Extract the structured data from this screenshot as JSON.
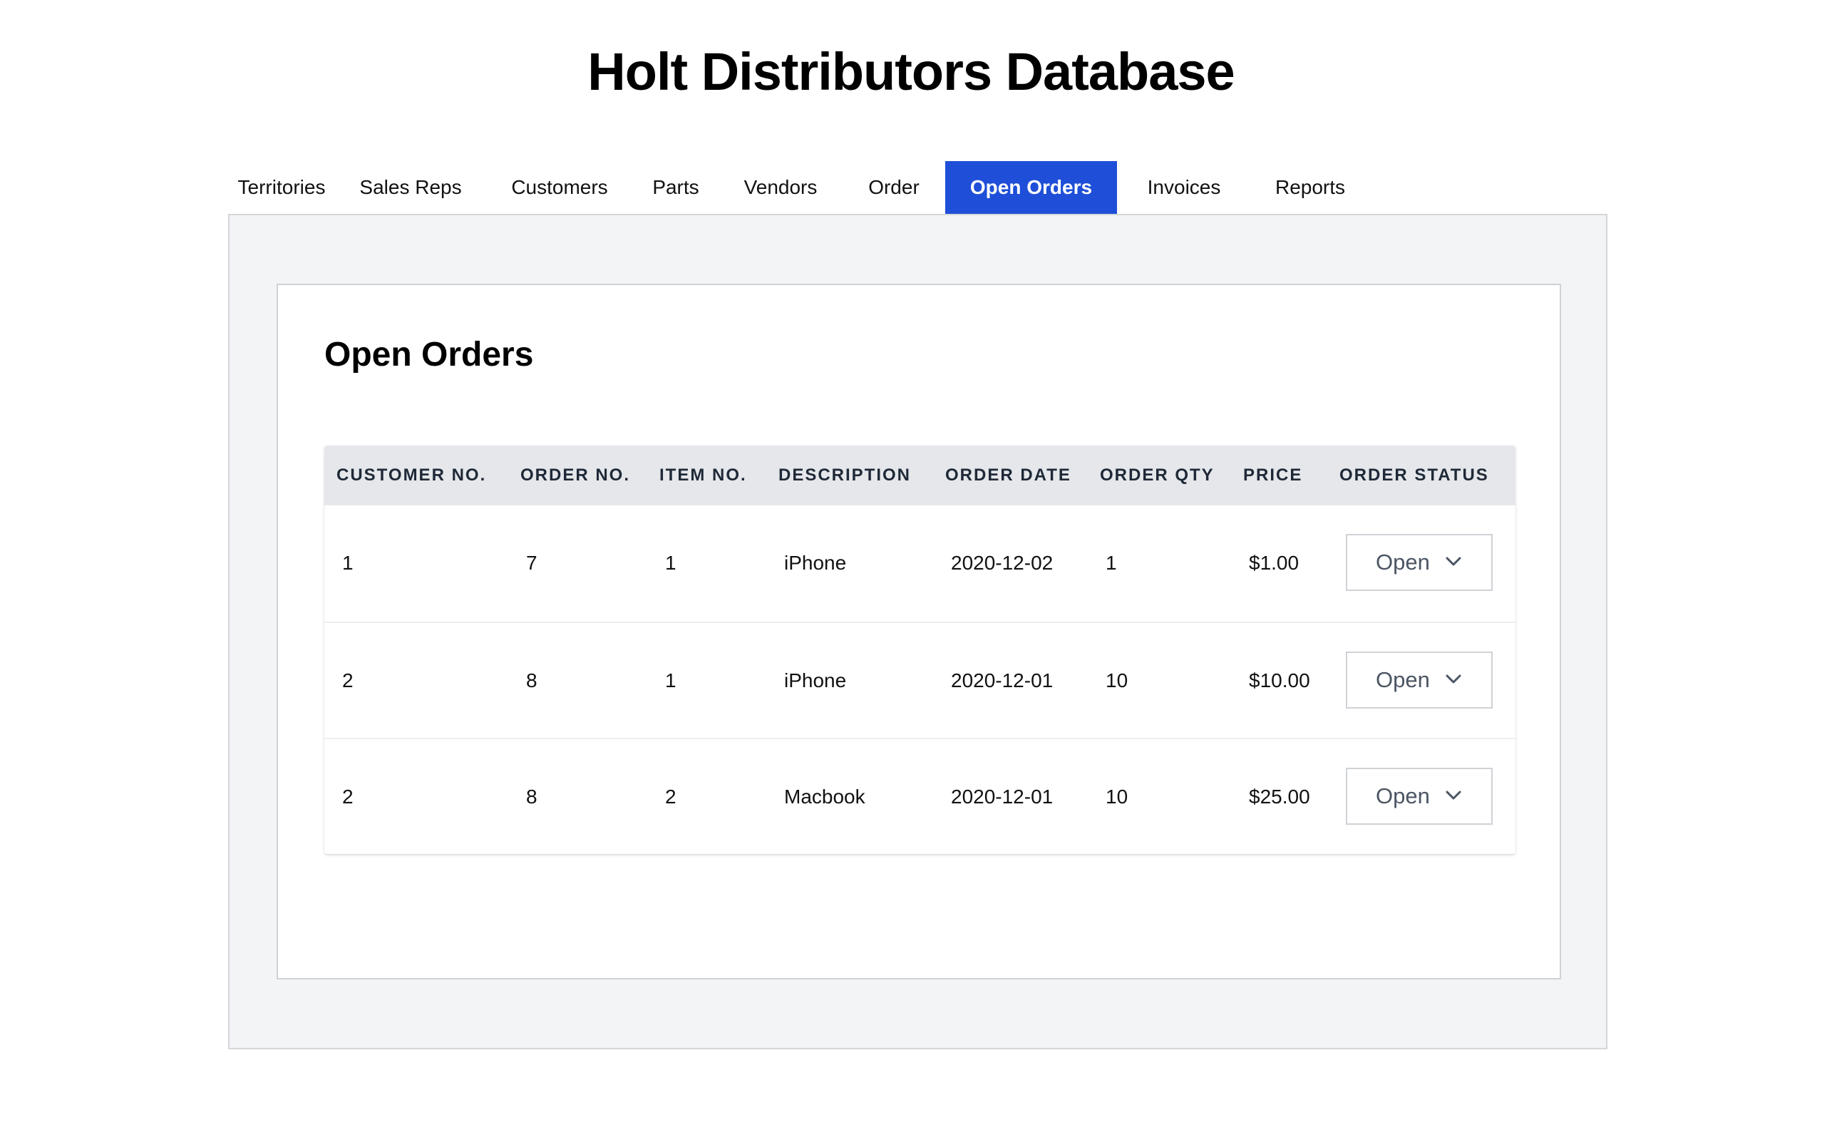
{
  "app": {
    "title": "Holt Distributors Database"
  },
  "tabs": [
    {
      "label": "Territories"
    },
    {
      "label": "Sales Reps"
    },
    {
      "label": "Customers"
    },
    {
      "label": "Parts"
    },
    {
      "label": "Vendors"
    },
    {
      "label": "Order"
    },
    {
      "label": "Open Orders"
    },
    {
      "label": "Invoices"
    },
    {
      "label": "Reports"
    }
  ],
  "active_tab": "Open Orders",
  "colors": {
    "accent": "#1f4fd8",
    "panel_bg": "#f3f4f6",
    "header_bg": "#e5e7eb"
  },
  "section": {
    "title": "Open Orders"
  },
  "table": {
    "columns": [
      {
        "label": "CUSTOMER NO."
      },
      {
        "label": "ORDER NO."
      },
      {
        "label": "ITEM NO."
      },
      {
        "label": "DESCRIPTION"
      },
      {
        "label": "ORDER DATE"
      },
      {
        "label": "ORDER QTY"
      },
      {
        "label": "PRICE"
      },
      {
        "label": "ORDER STATUS"
      }
    ],
    "rows": [
      {
        "customer_no": "1",
        "order_no": "7",
        "item_no": "1",
        "description": "iPhone",
        "order_date": "2020-12-02",
        "order_qty": "1",
        "price": "$1.00",
        "status": "Open"
      },
      {
        "customer_no": "2",
        "order_no": "8",
        "item_no": "1",
        "description": "iPhone",
        "order_date": "2020-12-01",
        "order_qty": "10",
        "price": "$10.00",
        "status": "Open"
      },
      {
        "customer_no": "2",
        "order_no": "8",
        "item_no": "2",
        "description": "Macbook",
        "order_date": "2020-12-01",
        "order_qty": "10",
        "price": "$25.00",
        "status": "Open"
      }
    ]
  },
  "icons": {
    "status_dropdown": "chevron-down-icon"
  }
}
